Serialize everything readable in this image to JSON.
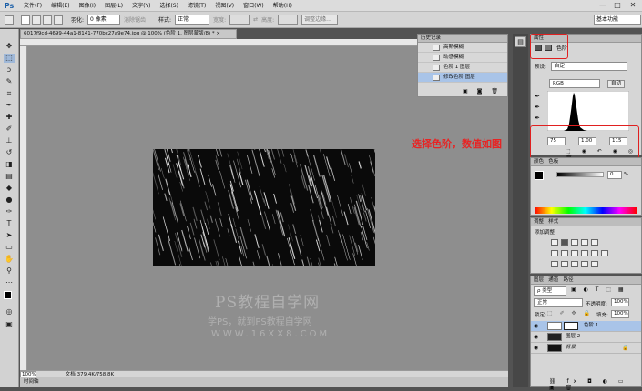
{
  "app": {
    "logo": "Ps",
    "workspace": "基本功能"
  },
  "menu": [
    "文件(F)",
    "编辑(E)",
    "图像(I)",
    "图层(L)",
    "文字(Y)",
    "选择(S)",
    "滤镜(T)",
    "视图(V)",
    "窗口(W)",
    "帮助(H)"
  ],
  "window_controls": [
    "—",
    "□",
    "✕"
  ],
  "options": {
    "feather_label": "羽化:",
    "feather_value": "0 像素",
    "antialias": "消除锯齿",
    "style_label": "样式:",
    "style_value": "正常",
    "width_label": "宽度:",
    "height_label": "高度:",
    "refine_button": "调整边缘..."
  },
  "document": {
    "tab_title": "6017f9cd-4699-44a1-8141-770bc27a9e74.jpg @ 100% (色阶 1, 图层蒙版/8) *",
    "tab_close": "×",
    "zoom": "100%",
    "doc_info": "文档:379.4K/758.8K",
    "bottom_tab": "时间轴"
  },
  "watermark": {
    "line1": "PS教程自学网",
    "line2": "学PS，就到PS教程自学网",
    "line3": "WWW.16XX8.COM"
  },
  "history": {
    "title": "历史记录",
    "items": [
      "高斯模糊",
      "动感模糊",
      "色阶 1 图层",
      "修改色阶 图层"
    ]
  },
  "properties": {
    "tab": "属性",
    "adjustment": "色阶",
    "preset_label": "预设:",
    "preset_value": "自定",
    "channel": "RGB",
    "auto_button": "自动",
    "input_black": "75",
    "input_gamma": "1.00",
    "input_white": "115"
  },
  "annotation": {
    "text": "选择色阶，数值如图",
    "color": "#e82323"
  },
  "color_panel": {
    "tabs": [
      "颜色",
      "色板"
    ],
    "value": "0",
    "pct": "%"
  },
  "adjustments_panel": {
    "tabs": [
      "调整",
      "样式"
    ],
    "title": "添加调整"
  },
  "layers": {
    "tabs": [
      "图层",
      "通道",
      "路径"
    ],
    "filter": "ρ 类型",
    "blend_mode": "正常",
    "opacity_label": "不透明度:",
    "opacity": "100%",
    "lock_label": "锁定:",
    "fill_label": "填充:",
    "fill": "100%",
    "items": [
      {
        "name": "色阶 1",
        "selected": true
      },
      {
        "name": "图层 2",
        "selected": false
      },
      {
        "name": "背景",
        "selected": false
      }
    ]
  }
}
